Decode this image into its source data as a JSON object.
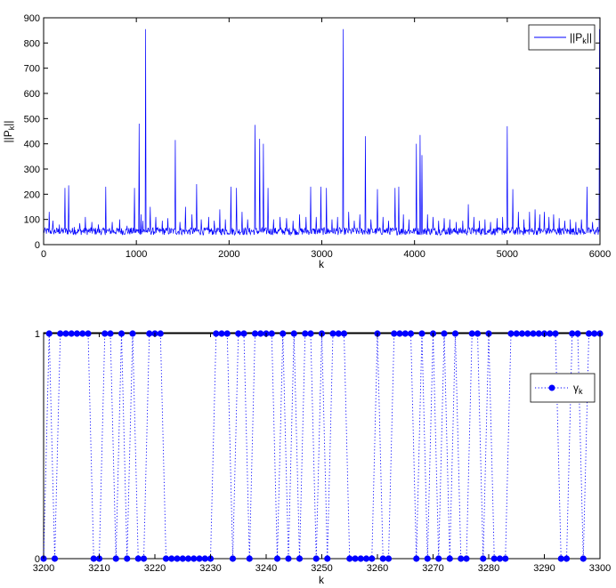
{
  "chart_data": [
    {
      "type": "line",
      "xlabel": "k",
      "ylabel": "||P_k||",
      "ylabel_main": "||P",
      "ylabel_sub": "k",
      "ylabel_tail": "||",
      "xlim": [
        0,
        6000
      ],
      "ylim": [
        0,
        900
      ],
      "xticks": [
        0,
        1000,
        2000,
        3000,
        4000,
        5000,
        6000
      ],
      "yticks": [
        0,
        100,
        200,
        300,
        400,
        500,
        600,
        700,
        800,
        900
      ],
      "grid": false,
      "legend": "top-right",
      "line_color": "#0000ff",
      "baseline_min": 38,
      "baseline_max": 68,
      "spikes": [
        [
          60,
          130
        ],
        [
          100,
          95
        ],
        [
          170,
          80
        ],
        [
          230,
          225
        ],
        [
          270,
          235
        ],
        [
          330,
          70
        ],
        [
          390,
          85
        ],
        [
          450,
          110
        ],
        [
          520,
          90
        ],
        [
          590,
          80
        ],
        [
          670,
          230
        ],
        [
          740,
          90
        ],
        [
          820,
          100
        ],
        [
          900,
          75
        ],
        [
          980,
          225
        ],
        [
          1030,
          480
        ],
        [
          1050,
          120
        ],
        [
          1070,
          95
        ],
        [
          1100,
          855
        ],
        [
          1150,
          150
        ],
        [
          1210,
          110
        ],
        [
          1280,
          95
        ],
        [
          1340,
          105
        ],
        [
          1420,
          415
        ],
        [
          1470,
          90
        ],
        [
          1530,
          150
        ],
        [
          1600,
          120
        ],
        [
          1650,
          240
        ],
        [
          1700,
          100
        ],
        [
          1780,
          110
        ],
        [
          1840,
          95
        ],
        [
          1900,
          140
        ],
        [
          1960,
          100
        ],
        [
          2020,
          230
        ],
        [
          2080,
          225
        ],
        [
          2140,
          130
        ],
        [
          2200,
          100
        ],
        [
          2280,
          475
        ],
        [
          2330,
          420
        ],
        [
          2370,
          400
        ],
        [
          2420,
          225
        ],
        [
          2480,
          100
        ],
        [
          2550,
          110
        ],
        [
          2620,
          105
        ],
        [
          2690,
          95
        ],
        [
          2760,
          120
        ],
        [
          2830,
          110
        ],
        [
          2880,
          230
        ],
        [
          2940,
          110
        ],
        [
          2990,
          230
        ],
        [
          3050,
          225
        ],
        [
          3110,
          100
        ],
        [
          3170,
          110
        ],
        [
          3230,
          855
        ],
        [
          3290,
          130
        ],
        [
          3350,
          95
        ],
        [
          3410,
          120
        ],
        [
          3470,
          430
        ],
        [
          3530,
          100
        ],
        [
          3600,
          220
        ],
        [
          3660,
          110
        ],
        [
          3720,
          95
        ],
        [
          3790,
          225
        ],
        [
          3830,
          230
        ],
        [
          3880,
          120
        ],
        [
          3940,
          100
        ],
        [
          4020,
          400
        ],
        [
          4060,
          435
        ],
        [
          4080,
          355
        ],
        [
          4140,
          120
        ],
        [
          4200,
          110
        ],
        [
          4260,
          95
        ],
        [
          4320,
          105
        ],
        [
          4380,
          100
        ],
        [
          4450,
          90
        ],
        [
          4520,
          95
        ],
        [
          4580,
          160
        ],
        [
          4640,
          110
        ],
        [
          4700,
          95
        ],
        [
          4760,
          100
        ],
        [
          4820,
          90
        ],
        [
          4890,
          105
        ],
        [
          4950,
          110
        ],
        [
          5000,
          470
        ],
        [
          5060,
          220
        ],
        [
          5120,
          130
        ],
        [
          5180,
          100
        ],
        [
          5240,
          130
        ],
        [
          5300,
          140
        ],
        [
          5350,
          120
        ],
        [
          5400,
          130
        ],
        [
          5450,
          110
        ],
        [
          5500,
          120
        ],
        [
          5560,
          105
        ],
        [
          5620,
          95
        ],
        [
          5680,
          100
        ],
        [
          5740,
          90
        ],
        [
          5800,
          100
        ],
        [
          5860,
          230
        ],
        [
          5920,
          90
        ],
        [
          5975,
          70
        ],
        [
          5993,
          300
        ],
        [
          5997,
          855
        ]
      ],
      "series": [
        {
          "name": "||P_k||",
          "legend_main": "||P",
          "legend_sub": "k",
          "legend_tail": "||"
        }
      ]
    },
    {
      "type": "line",
      "style": "dotted-with-markers",
      "xlabel": "k",
      "ylabel": "",
      "xlim": [
        3200,
        3300
      ],
      "ylim": [
        0,
        1
      ],
      "xticks": [
        3200,
        3210,
        3220,
        3230,
        3240,
        3250,
        3260,
        3270,
        3280,
        3290,
        3300
      ],
      "yticks": [
        0,
        1
      ],
      "grid": false,
      "legend": "right",
      "line_color": "#0000ff",
      "x_start": 3200,
      "values": [
        0,
        1,
        0,
        1,
        1,
        1,
        1,
        1,
        1,
        0,
        0,
        1,
        1,
        0,
        1,
        0,
        1,
        0,
        0,
        1,
        1,
        1,
        0,
        0,
        0,
        0,
        0,
        0,
        0,
        0,
        0,
        1,
        1,
        1,
        0,
        1,
        1,
        0,
        1,
        1,
        1,
        1,
        0,
        1,
        0,
        1,
        0,
        1,
        1,
        0,
        1,
        0,
        1,
        1,
        1,
        0,
        0,
        0,
        0,
        0,
        1,
        0,
        0,
        1,
        1,
        1,
        1,
        0,
        1,
        0,
        1,
        0,
        1,
        0,
        1,
        0,
        0,
        1,
        1,
        0,
        1,
        0,
        0,
        0,
        1,
        1,
        1,
        1,
        1,
        1,
        1,
        1,
        1,
        0,
        0,
        1,
        1,
        0,
        1,
        1,
        1
      ],
      "series": [
        {
          "name": "γ_k",
          "legend_main": "γ",
          "legend_sub": "k"
        }
      ]
    }
  ]
}
